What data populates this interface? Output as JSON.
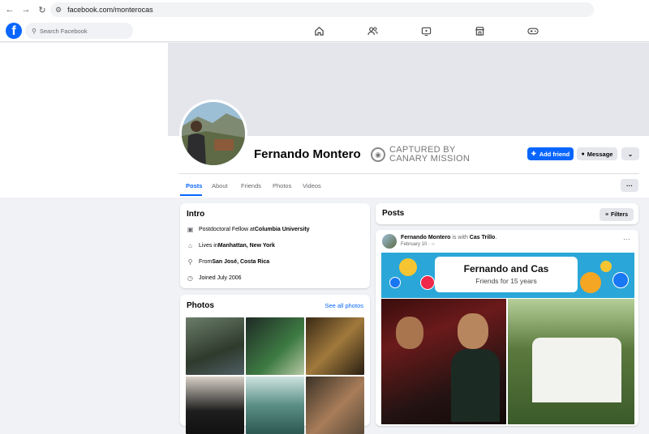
{
  "browser": {
    "url": "facebook.com/monterocas",
    "back": "←",
    "forward": "→",
    "reload": "↻"
  },
  "fb": {
    "logo": "f",
    "search_placeholder": "Search Facebook"
  },
  "profile": {
    "name": "Fernando Montero",
    "captured_line1": "CAPTURED BY",
    "captured_line2": "CANARY MISSION",
    "add_friend": "Add friend",
    "message": "Message",
    "more": "⌄",
    "tabs": [
      "Posts",
      "About",
      "Friends",
      "Photos",
      "Videos"
    ],
    "tab_more": "···"
  },
  "intro": {
    "title": "Intro",
    "rows": [
      {
        "pre": "Postdoctoral Fellow at ",
        "bold": "Columbia University",
        "icon": "briefcase-icon"
      },
      {
        "pre": "Lives in ",
        "bold": "Manhattan, New York",
        "icon": "home-icon"
      },
      {
        "pre": "From ",
        "bold": "San José, Costa Rica",
        "icon": "location-pin-icon"
      },
      {
        "pre": "Joined July 2006",
        "bold": "",
        "icon": "clock-icon"
      }
    ]
  },
  "photos": {
    "title": "Photos",
    "see_all": "See all photos"
  },
  "posts": {
    "title": "Posts",
    "filters": "Filters"
  },
  "post": {
    "author": "Fernando Montero",
    "with_text": " is with ",
    "friend": "Cas Trillo",
    "period": ".",
    "date": "February 10 ·",
    "options": "···",
    "banner_title": "Fernando and Cas",
    "banner_sub": "Friends for 15 years"
  },
  "colors": {
    "accent": "#0866ff",
    "page_bg": "#f0f2f5",
    "banner": "#2aa7d8"
  }
}
